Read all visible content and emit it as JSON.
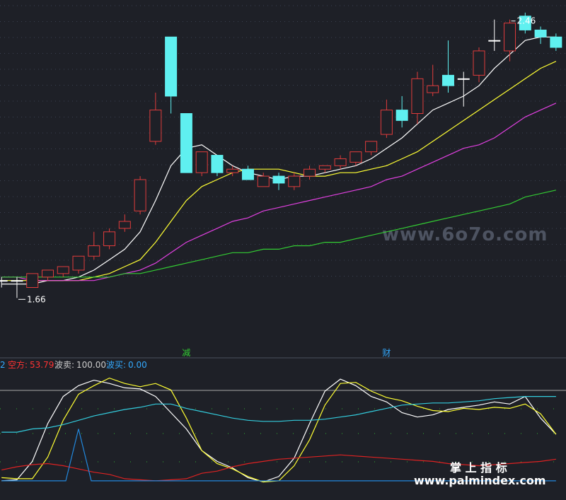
{
  "colors": {
    "background": "#1e2027",
    "grid": "#3a4050",
    "up": "#e03c3c",
    "down": "#5ff0f0",
    "flat": "#ffffff",
    "ma5": "#ffffff",
    "ma10": "#ffff33",
    "ma20": "#e040e0",
    "ma60": "#33cc33",
    "osc_white": "#ffffff",
    "osc_yellow": "#ffff33",
    "osc_cyan": "#33ccdd",
    "osc_red": "#dd2222",
    "osc_blue": "#2288dd",
    "kong": "#ff3333",
    "bomai": "#cccccc",
    "bomai_buy": "#33aaff"
  },
  "watermark": "www.6o7o.com",
  "brand": {
    "line1": "掌 上 指 标",
    "line2": "www.palmindex.com"
  },
  "indicator_header": {
    "prefix": "2",
    "kong_label": "空方:",
    "kong_value": "53.79",
    "sell_label": "波卖:",
    "sell_value": "100.00",
    "buy_label": "波买:",
    "buy_value": "0.00"
  },
  "chart_data": [
    {
      "type": "candlestick",
      "title": "",
      "annotations": [
        {
          "text": "2.46",
          "kind": "high",
          "bar": 33
        },
        {
          "text": "1.66",
          "kind": "low",
          "bar": 1
        },
        {
          "text": "减",
          "bar": 12
        },
        {
          "text": "财",
          "bar": 25
        }
      ],
      "ylim": [
        1.5,
        2.5
      ],
      "grid": true,
      "candles": [
        {
          "o": 1.71,
          "h": 1.72,
          "l": 1.69,
          "c": 1.71
        },
        {
          "o": 1.71,
          "h": 1.72,
          "l": 1.66,
          "c": 1.71
        },
        {
          "o": 1.69,
          "h": 1.73,
          "l": 1.69,
          "c": 1.73
        },
        {
          "o": 1.72,
          "h": 1.74,
          "l": 1.71,
          "c": 1.74
        },
        {
          "o": 1.73,
          "h": 1.75,
          "l": 1.72,
          "c": 1.75
        },
        {
          "o": 1.74,
          "h": 1.78,
          "l": 1.73,
          "c": 1.78
        },
        {
          "o": 1.78,
          "h": 1.85,
          "l": 1.77,
          "c": 1.81
        },
        {
          "o": 1.81,
          "h": 1.86,
          "l": 1.8,
          "c": 1.85
        },
        {
          "o": 1.86,
          "h": 1.9,
          "l": 1.85,
          "c": 1.88
        },
        {
          "o": 1.91,
          "h": 2.01,
          "l": 1.9,
          "c": 2.0
        },
        {
          "o": 2.11,
          "h": 2.25,
          "l": 2.1,
          "c": 2.2
        },
        {
          "o": 2.41,
          "h": 2.41,
          "l": 2.19,
          "c": 2.24
        },
        {
          "o": 2.19,
          "h": 2.19,
          "l": 2.02,
          "c": 2.02
        },
        {
          "o": 2.02,
          "h": 2.08,
          "l": 2.01,
          "c": 2.08
        },
        {
          "o": 2.07,
          "h": 2.07,
          "l": 2.01,
          "c": 2.02
        },
        {
          "o": 2.02,
          "h": 2.04,
          "l": 2.01,
          "c": 2.03
        },
        {
          "o": 2.03,
          "h": 2.04,
          "l": 2.0,
          "c": 2.0
        },
        {
          "o": 1.98,
          "h": 2.02,
          "l": 1.98,
          "c": 2.01
        },
        {
          "o": 2.01,
          "h": 2.02,
          "l": 1.97,
          "c": 1.99
        },
        {
          "o": 1.98,
          "h": 2.02,
          "l": 1.97,
          "c": 2.01
        },
        {
          "o": 2.01,
          "h": 2.04,
          "l": 2.0,
          "c": 2.03
        },
        {
          "o": 2.03,
          "h": 2.04,
          "l": 2.02,
          "c": 2.04
        },
        {
          "o": 2.04,
          "h": 2.07,
          "l": 2.03,
          "c": 2.06
        },
        {
          "o": 2.05,
          "h": 2.08,
          "l": 2.04,
          "c": 2.08
        },
        {
          "o": 2.08,
          "h": 2.11,
          "l": 2.07,
          "c": 2.11
        },
        {
          "o": 2.13,
          "h": 2.23,
          "l": 2.12,
          "c": 2.2
        },
        {
          "o": 2.2,
          "h": 2.24,
          "l": 2.15,
          "c": 2.17
        },
        {
          "o": 2.19,
          "h": 2.31,
          "l": 2.16,
          "c": 2.29
        },
        {
          "o": 2.25,
          "h": 2.33,
          "l": 2.24,
          "c": 2.27
        },
        {
          "o": 2.3,
          "h": 2.4,
          "l": 2.25,
          "c": 2.27
        },
        {
          "o": 2.29,
          "h": 2.31,
          "l": 2.21,
          "c": 2.29
        },
        {
          "o": 2.3,
          "h": 2.38,
          "l": 2.28,
          "c": 2.37
        },
        {
          "o": 2.4,
          "h": 2.46,
          "l": 2.37,
          "c": 2.4
        },
        {
          "o": 2.37,
          "h": 2.46,
          "l": 2.34,
          "c": 2.45
        },
        {
          "o": 2.47,
          "h": 2.48,
          "l": 2.42,
          "c": 2.43
        },
        {
          "o": 2.43,
          "h": 2.44,
          "l": 2.39,
          "c": 2.41
        },
        {
          "o": 2.41,
          "h": 2.42,
          "l": 2.37,
          "c": 2.38
        }
      ],
      "series": [
        {
          "color": "#ffffff",
          "values": [
            1.7,
            1.7,
            1.7,
            1.71,
            1.71,
            1.72,
            1.74,
            1.77,
            1.8,
            1.85,
            1.94,
            2.04,
            2.09,
            2.1,
            2.07,
            2.04,
            2.02,
            2.01,
            2.0,
            2.01,
            2.01,
            2.02,
            2.03,
            2.04,
            2.06,
            2.09,
            2.12,
            2.16,
            2.2,
            2.22,
            2.24,
            2.27,
            2.32,
            2.36,
            2.4,
            2.41,
            2.41
          ]
        },
        {
          "color": "#ffff33",
          "values": [
            1.71,
            1.71,
            1.71,
            1.71,
            1.71,
            1.71,
            1.72,
            1.73,
            1.75,
            1.77,
            1.82,
            1.88,
            1.94,
            1.98,
            2.0,
            2.02,
            2.03,
            2.03,
            2.03,
            2.02,
            2.01,
            2.01,
            2.02,
            2.02,
            2.03,
            2.04,
            2.06,
            2.08,
            2.11,
            2.14,
            2.17,
            2.2,
            2.23,
            2.26,
            2.29,
            2.32,
            2.34
          ]
        },
        {
          "color": "#e040e0",
          "values": [
            1.72,
            1.72,
            1.71,
            1.71,
            1.71,
            1.71,
            1.71,
            1.72,
            1.73,
            1.74,
            1.76,
            1.79,
            1.82,
            1.84,
            1.86,
            1.88,
            1.89,
            1.91,
            1.92,
            1.93,
            1.94,
            1.95,
            1.96,
            1.97,
            1.98,
            2.0,
            2.01,
            2.03,
            2.05,
            2.07,
            2.09,
            2.1,
            2.12,
            2.15,
            2.18,
            2.2,
            2.22
          ]
        },
        {
          "color": "#33cc33",
          "values": [
            1.72,
            1.72,
            1.72,
            1.72,
            1.72,
            1.72,
            1.72,
            1.72,
            1.73,
            1.73,
            1.74,
            1.75,
            1.76,
            1.77,
            1.78,
            1.79,
            1.79,
            1.8,
            1.8,
            1.81,
            1.81,
            1.82,
            1.82,
            1.83,
            1.84,
            1.85,
            1.86,
            1.87,
            1.88,
            1.89,
            1.9,
            1.91,
            1.92,
            1.93,
            1.95,
            1.96,
            1.97
          ]
        }
      ]
    },
    {
      "type": "line",
      "title": "",
      "ylim": [
        0,
        100
      ],
      "grid": true,
      "series": [
        {
          "color": "#ffffff",
          "values": [
            2,
            3,
            20,
            55,
            80,
            90,
            95,
            92,
            88,
            87,
            80,
            65,
            50,
            30,
            20,
            14,
            5,
            1,
            6,
            23,
            55,
            85,
            96,
            90,
            80,
            75,
            65,
            61,
            63,
            68,
            70,
            72,
            75,
            73,
            80,
            60,
            45
          ]
        },
        {
          "color": "#ffff33",
          "values": [
            5,
            4,
            4,
            24,
            58,
            82,
            90,
            97,
            92,
            89,
            92,
            86,
            60,
            30,
            18,
            13,
            6,
            1,
            2,
            16,
            40,
            72,
            92,
            93,
            85,
            79,
            76,
            71,
            67,
            66,
            69,
            68,
            70,
            69,
            73,
            64,
            45
          ]
        },
        {
          "color": "#33ccdd",
          "values": [
            47,
            47,
            50,
            51,
            54,
            58,
            62,
            65,
            68,
            70,
            73,
            73,
            69,
            66,
            63,
            60,
            58,
            57,
            57,
            58,
            58,
            59,
            61,
            63,
            66,
            69,
            72,
            73,
            74,
            74,
            75,
            76,
            78,
            79,
            80,
            80,
            80
          ]
        },
        {
          "color": "#dd2222",
          "values": [
            12,
            15,
            17,
            18,
            16,
            13,
            10,
            8,
            4,
            3,
            2,
            3,
            4,
            9,
            11,
            15,
            18,
            20,
            22,
            23,
            24,
            25,
            26,
            25,
            24,
            23,
            22,
            21,
            20,
            18,
            17,
            16,
            17,
            18,
            19,
            20,
            22
          ]
        },
        {
          "color": "#2288dd",
          "values": [
            2,
            2,
            2,
            2,
            2,
            20,
            2,
            2,
            2,
            2,
            2,
            2,
            2,
            2,
            2,
            2,
            2,
            2,
            2,
            2,
            2,
            2,
            2,
            2,
            2,
            2,
            2,
            2,
            2,
            2,
            2,
            2,
            2,
            2,
            2,
            2,
            2
          ]
        }
      ]
    }
  ]
}
